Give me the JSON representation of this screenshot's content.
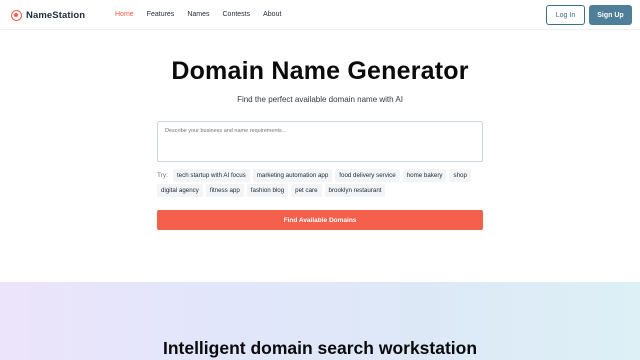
{
  "header": {
    "logo_text": "NameStation",
    "nav": [
      {
        "label": "Home",
        "active": true
      },
      {
        "label": "Features",
        "active": false
      },
      {
        "label": "Names",
        "active": false
      },
      {
        "label": "Contests",
        "active": false
      },
      {
        "label": "About",
        "active": false
      }
    ],
    "login_label": "Log In",
    "signup_label": "Sign Up"
  },
  "hero": {
    "title": "Domain Name Generator",
    "subtitle": "Find the perfect available domain name with AI",
    "input_placeholder": "Describe your business and name requirements...",
    "try_label": "Try:",
    "suggestions_row1": [
      "tech startup with AI focus",
      "marketing automation app",
      "food delivery service",
      "home bakery",
      "shop"
    ],
    "suggestions_row2": [
      "digital agency",
      "fitness app",
      "fashion blog",
      "pet care",
      "brooklyn restaurant"
    ],
    "submit_label": "Find Available Domains"
  },
  "section": {
    "title": "Intelligent domain search workstation"
  },
  "colors": {
    "accent": "#f4604b",
    "brand_blue": "#4f7f98"
  }
}
